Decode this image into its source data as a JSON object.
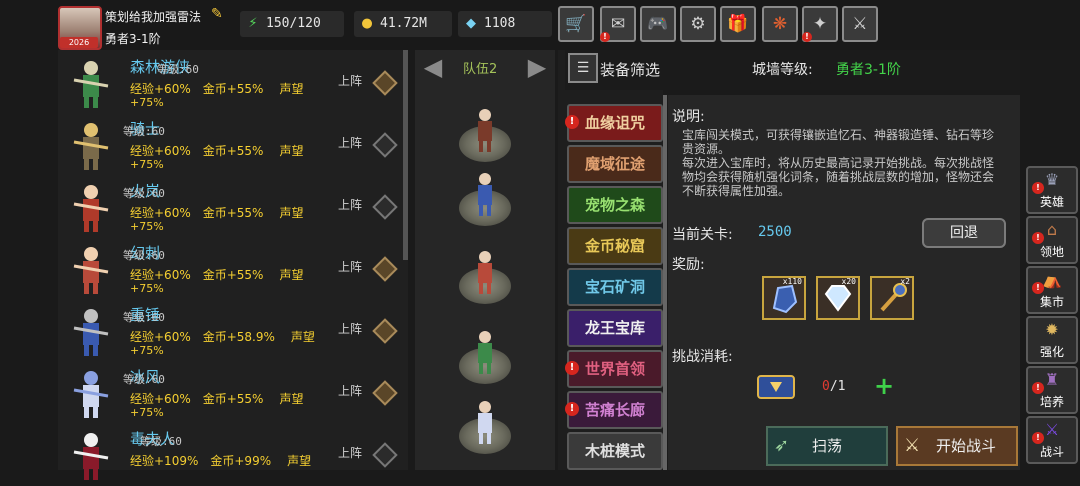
{
  "player": {
    "name": "策划给我加强雷法",
    "stage": "勇者3-1阶",
    "avatar_badge": "2026"
  },
  "resources": {
    "energy": "150/120",
    "gold": "41.72M",
    "gems": "1108"
  },
  "top_icons": [
    "shop-cart-icon",
    "no-ads-icon",
    "gamepad-icon",
    "settings-gear-icon",
    "gift-icon",
    "color-wheel-icon",
    "news-icon",
    "swords-icon"
  ],
  "heroes": [
    {
      "name": "森林游侠",
      "level": "等级:60",
      "exp": "经验+60%",
      "gold": "金币+55%",
      "fame": "声望",
      "bonus": "+75%",
      "deploy": "上阵",
      "active": true
    },
    {
      "name": "骑士",
      "level": "等级:60",
      "exp": "经验+60%",
      "gold": "金币+55%",
      "fame": "声望",
      "bonus": "+75%",
      "deploy": "上阵",
      "active": false
    },
    {
      "name": "火岚",
      "level": "等级:60",
      "exp": "经验+60%",
      "gold": "金币+55%",
      "fame": "声望",
      "bonus": "+75%",
      "deploy": "上阵",
      "active": false
    },
    {
      "name": "幻刺",
      "level": "等级:60",
      "exp": "经验+60%",
      "gold": "金币+55%",
      "fame": "声望",
      "bonus": "+75%",
      "deploy": "上阵",
      "active": true
    },
    {
      "name": "重锤",
      "level": "等级:60",
      "exp": "经验+60%",
      "gold": "金币+58.9%",
      "fame": "声望",
      "bonus": "+75%",
      "deploy": "上阵",
      "active": true
    },
    {
      "name": "冰风",
      "level": "等级:60",
      "exp": "经验+60%",
      "gold": "金币+55%",
      "fame": "声望",
      "bonus": "+75%",
      "deploy": "上阵",
      "active": true
    },
    {
      "name": "毒夫人",
      "level": "等级:60",
      "exp": "经验+109%",
      "gold": "金币+99%",
      "fame": "声望",
      "bonus": "",
      "deploy": "上阵",
      "active": false
    }
  ],
  "team": {
    "label": "队伍2"
  },
  "dungeon_tabs": [
    {
      "label": "血缘诅咒",
      "bg": "#7a1b1b",
      "fg": "#f0d0a0",
      "alert": true
    },
    {
      "label": "魔域征途",
      "bg": "#4a2a1a",
      "fg": "#e0a070",
      "alert": false
    },
    {
      "label": "宠物之森",
      "bg": "#1f4a1a",
      "fg": "#98e070",
      "alert": false
    },
    {
      "label": "金币秘窟",
      "bg": "#4a3a14",
      "fg": "#e8c858",
      "alert": false
    },
    {
      "label": "宝石矿洞",
      "bg": "#143a4a",
      "fg": "#70c8e8",
      "alert": false
    },
    {
      "label": "龙王宝库",
      "bg": "#3a1f6a",
      "fg": "#f0f0f0",
      "alert": false
    },
    {
      "label": "世界首领",
      "bg": "#4a1a2a",
      "fg": "#e06080",
      "alert": true
    },
    {
      "label": "苦痛长廊",
      "bg": "#3a1a3a",
      "fg": "#d080d0",
      "alert": true
    },
    {
      "label": "木桩模式",
      "bg": "#3a3a3a",
      "fg": "#e0e0e0",
      "alert": false
    }
  ],
  "header": {
    "filter_label": "装备筛选",
    "wall_label": "城墙等级:",
    "wall_value": "勇者3-1阶"
  },
  "detail": {
    "desc_title": "说明:",
    "desc_text": "宝库闯关模式，可获得镶嵌追忆石、神器锻造锤、钻石等珍贵资源。\n每次进入宝库时，将从历史最高记录开始挑战。每次挑战怪物均会获得随机强化词条，随着挑战层数的增加，怪物还会不断获得属性加强。",
    "stage_label": "当前关卡:",
    "stage_value": "2500",
    "back_label": "回退",
    "reward_label": "奖励:",
    "rewards": [
      {
        "icon": "blue-stone-icon",
        "count": "x110"
      },
      {
        "icon": "diamond-icon",
        "count": "x20"
      },
      {
        "icon": "forge-hammer-icon",
        "count": "x2"
      }
    ],
    "cost_label": "挑战消耗:",
    "cost_have": "0",
    "cost_need": "/1",
    "sweep_label": "扫荡",
    "battle_label": "开始战斗"
  },
  "side_menu": [
    {
      "label": "英雄",
      "icon": "hero-icon",
      "alert": true
    },
    {
      "label": "领地",
      "icon": "territory-icon",
      "alert": true
    },
    {
      "label": "集市",
      "icon": "market-icon",
      "alert": true
    },
    {
      "label": "强化",
      "icon": "enhance-icon",
      "alert": false
    },
    {
      "label": "培养",
      "icon": "cultivate-icon",
      "alert": true
    },
    {
      "label": "战斗",
      "icon": "battle-icon",
      "alert": true
    }
  ]
}
